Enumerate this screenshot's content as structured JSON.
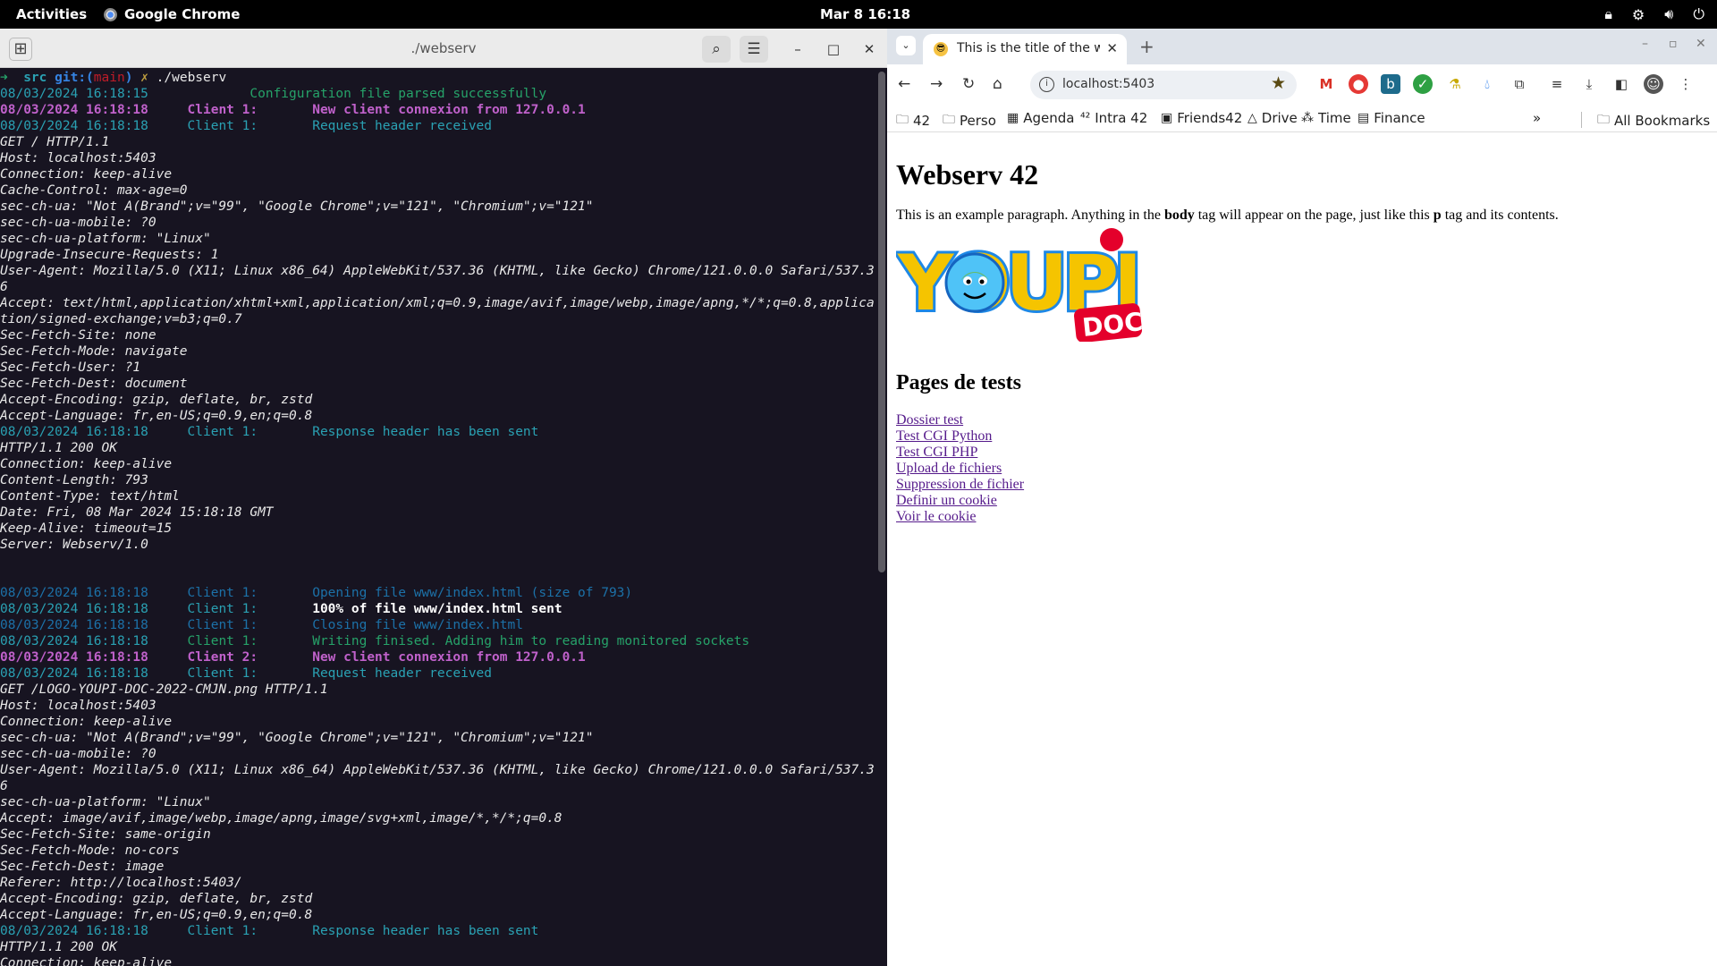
{
  "topbar": {
    "activities": "Activities",
    "app_name": "Google Chrome",
    "clock": "Mar 8  16:18"
  },
  "terminal": {
    "title": "./webserv",
    "prompt_dir": "src",
    "prompt_git": "git:(",
    "prompt_branch": "main",
    "prompt_git_close": ")",
    "prompt_dirty": "✗",
    "prompt_cmd": "./webserv",
    "lines": [
      {
        "type": "log",
        "ts": "08/03/2024 16:18:15",
        "client": "",
        "msg": "Configuration file parsed successfully",
        "style": "green"
      },
      {
        "type": "log",
        "ts": "08/03/2024 16:18:18",
        "client": "Client 1:",
        "msg": "New client connexion from 127.0.0.1",
        "style": "bright"
      },
      {
        "type": "log",
        "ts": "08/03/2024 16:18:18",
        "client": "Client 1:",
        "msg": "Request header received",
        "style": "cyan"
      },
      {
        "type": "text",
        "text": "GET / HTTP/1.1"
      },
      {
        "type": "text",
        "text": "Host: localhost:5403"
      },
      {
        "type": "text",
        "text": "Connection: keep-alive"
      },
      {
        "type": "text",
        "text": "Cache-Control: max-age=0"
      },
      {
        "type": "text",
        "text": "sec-ch-ua: \"Not A(Brand\";v=\"99\", \"Google Chrome\";v=\"121\", \"Chromium\";v=\"121\""
      },
      {
        "type": "text",
        "text": "sec-ch-ua-mobile: ?0"
      },
      {
        "type": "text",
        "text": "sec-ch-ua-platform: \"Linux\""
      },
      {
        "type": "text",
        "text": "Upgrade-Insecure-Requests: 1"
      },
      {
        "type": "wrap",
        "text": "User-Agent: Mozilla/5.0 (X11; Linux x86_64) AppleWebKit/537.36 (KHTML, like Gecko) Chrome/121.0.0.0 Safari/537.36"
      },
      {
        "type": "wrap",
        "text": "Accept: text/html,application/xhtml+xml,application/xml;q=0.9,image/avif,image/webp,image/apng,*/*;q=0.8,application/signed-exchange;v=b3;q=0.7"
      },
      {
        "type": "text",
        "text": "Sec-Fetch-Site: none"
      },
      {
        "type": "text",
        "text": "Sec-Fetch-Mode: navigate"
      },
      {
        "type": "text",
        "text": "Sec-Fetch-User: ?1"
      },
      {
        "type": "text",
        "text": "Sec-Fetch-Dest: document"
      },
      {
        "type": "text",
        "text": "Accept-Encoding: gzip, deflate, br, zstd"
      },
      {
        "type": "text",
        "text": "Accept-Language: fr,en-US;q=0.9,en;q=0.8"
      },
      {
        "type": "log",
        "ts": "08/03/2024 16:18:18",
        "client": "Client 1:",
        "msg": "Response header has been sent",
        "style": "cyan"
      },
      {
        "type": "text",
        "text": "HTTP/1.1 200 OK"
      },
      {
        "type": "text",
        "text": "Connection: keep-alive"
      },
      {
        "type": "text",
        "text": "Content-Length: 793"
      },
      {
        "type": "text",
        "text": "Content-Type: text/html"
      },
      {
        "type": "text",
        "text": "Date: Fri, 08 Mar 2024 15:18:18 GMT"
      },
      {
        "type": "text",
        "text": "Keep-Alive: timeout=15"
      },
      {
        "type": "text",
        "text": "Server: Webserv/1.0"
      },
      {
        "type": "blank"
      },
      {
        "type": "blank"
      },
      {
        "type": "log",
        "ts": "08/03/2024 16:18:18",
        "client": "Client 1:",
        "msg": "Opening file www/index.html (size of 793)",
        "style": "dim"
      },
      {
        "type": "log",
        "ts": "08/03/2024 16:18:18",
        "client": "Client 1:",
        "msg": "100% of file www/index.html sent",
        "style": "cyan-white"
      },
      {
        "type": "log",
        "ts": "08/03/2024 16:18:18",
        "client": "Client 1:",
        "msg": "Closing file www/index.html",
        "style": "dim"
      },
      {
        "type": "log",
        "ts": "08/03/2024 16:18:18",
        "client": "Client 1:",
        "msg": "Writing finised. Adding him to reading monitored sockets",
        "style": "green"
      },
      {
        "type": "log",
        "ts": "08/03/2024 16:18:18",
        "client": "Client 2:",
        "msg": "New client connexion from 127.0.0.1",
        "style": "bright"
      },
      {
        "type": "log",
        "ts": "08/03/2024 16:18:18",
        "client": "Client 1:",
        "msg": "Request header received",
        "style": "cyan"
      },
      {
        "type": "text",
        "text": "GET /LOGO-YOUPI-DOC-2022-CMJN.png HTTP/1.1"
      },
      {
        "type": "text",
        "text": "Host: localhost:5403"
      },
      {
        "type": "text",
        "text": "Connection: keep-alive"
      },
      {
        "type": "text",
        "text": "sec-ch-ua: \"Not A(Brand\";v=\"99\", \"Google Chrome\";v=\"121\", \"Chromium\";v=\"121\""
      },
      {
        "type": "text",
        "text": "sec-ch-ua-mobile: ?0"
      },
      {
        "type": "wrap",
        "text": "User-Agent: Mozilla/5.0 (X11; Linux x86_64) AppleWebKit/537.36 (KHTML, like Gecko) Chrome/121.0.0.0 Safari/537.36"
      },
      {
        "type": "text",
        "text": "sec-ch-ua-platform: \"Linux\""
      },
      {
        "type": "text",
        "text": "Accept: image/avif,image/webp,image/apng,image/svg+xml,image/*,*/*;q=0.8"
      },
      {
        "type": "text",
        "text": "Sec-Fetch-Site: same-origin"
      },
      {
        "type": "text",
        "text": "Sec-Fetch-Mode: no-cors"
      },
      {
        "type": "text",
        "text": "Sec-Fetch-Dest: image"
      },
      {
        "type": "text",
        "text": "Referer: http://localhost:5403/"
      },
      {
        "type": "text",
        "text": "Accept-Encoding: gzip, deflate, br, zstd"
      },
      {
        "type": "text",
        "text": "Accept-Language: fr,en-US;q=0.9,en;q=0.8"
      },
      {
        "type": "log",
        "ts": "08/03/2024 16:18:18",
        "client": "Client 1:",
        "msg": "Response header has been sent",
        "style": "cyan"
      },
      {
        "type": "text",
        "text": "HTTP/1.1 200 OK"
      },
      {
        "type": "text",
        "text": "Connection: keep-alive"
      }
    ]
  },
  "browser": {
    "tab_title": "This is the title of the webpage",
    "url": "localhost:5403",
    "bookmarks": [
      {
        "label": "42",
        "icon": "folder-icon"
      },
      {
        "label": "Perso",
        "icon": "folder-icon"
      },
      {
        "label": "Agenda",
        "icon": "calendar-icon"
      },
      {
        "label": "Intra 42",
        "icon": "42-logo-icon"
      },
      {
        "label": "Friends42",
        "icon": "friends42-icon"
      },
      {
        "label": "Drive",
        "icon": "drive-icon"
      },
      {
        "label": "Time",
        "icon": "time-icon"
      },
      {
        "label": "Finance",
        "icon": "finance-icon"
      }
    ],
    "all_bookmarks": "All Bookmarks",
    "page": {
      "heading": "Webserv 42",
      "para_1": "This is an example paragraph. Anything in the ",
      "para_b1": "body",
      "para_2": " tag will appear on the page, just like this ",
      "para_b2": "p",
      "para_3": " tag and its contents.",
      "logo_text": "YOUPI",
      "logo_sub": "DOC",
      "subheading": "Pages de tests",
      "links": [
        "Dossier test",
        "Test CGI Python",
        "Test CGI PHP",
        "Upload de fichiers",
        "Suppression de fichier",
        "Definir un cookie",
        "Voir le cookie"
      ]
    }
  }
}
